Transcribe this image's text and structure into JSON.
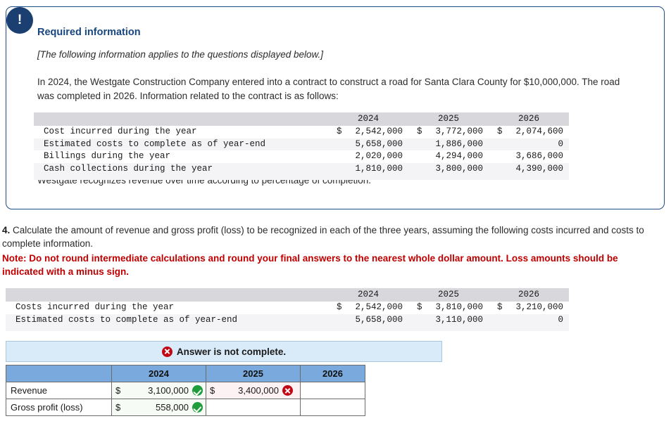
{
  "colors": {
    "panel_border": "#1f4e87",
    "badge_bg": "#1b3f70",
    "title_blue": "#17457e",
    "note_red": "#c00000",
    "banner_bg": "#d9eaf8",
    "banner_border": "#a9c9e2",
    "grid_header_blue": "#7aaadd",
    "correct_green": "#1f9c3b",
    "incorrect_red": "#c00713",
    "mono_header_gray": "#d7d7dc",
    "mono_stripe_gray": "#f4f4f6"
  },
  "required_info": {
    "badge_glyph": "!",
    "title": "Required information",
    "italic_note": "[The following information applies to the questions displayed below.]",
    "paragraph": "In 2024, the Westgate Construction Company entered into a contract to construct a road for Santa Clara County for $10,000,000. The road was completed in 2026. Information related to the contract is as follows:",
    "footer": "Westgate recognizes revenue over time according to percentage of completion."
  },
  "contract_table": {
    "blank_header": "",
    "columns": [
      "2024",
      "2025",
      "2026"
    ],
    "rows": [
      {
        "label": "Cost incurred during the year",
        "cells": [
          {
            "currency": "$",
            "amount": "2,542,000"
          },
          {
            "currency": "$",
            "amount": "3,772,000"
          },
          {
            "currency": "$",
            "amount": "2,074,600"
          }
        ]
      },
      {
        "label": "Estimated costs to complete as of year-end",
        "cells": [
          {
            "currency": "",
            "amount": "5,658,000"
          },
          {
            "currency": "",
            "amount": "1,886,000"
          },
          {
            "currency": "",
            "amount": "0"
          }
        ]
      },
      {
        "label": "Billings during the year",
        "cells": [
          {
            "currency": "",
            "amount": "2,020,000"
          },
          {
            "currency": "",
            "amount": "4,294,000"
          },
          {
            "currency": "",
            "amount": "3,686,000"
          }
        ]
      },
      {
        "label": "Cash collections during the year",
        "cells": [
          {
            "currency": "",
            "amount": "1,810,000"
          },
          {
            "currency": "",
            "amount": "3,800,000"
          },
          {
            "currency": "",
            "amount": "4,390,000"
          }
        ]
      }
    ]
  },
  "question": {
    "number": "4.",
    "text": "Calculate the amount of revenue and gross profit (loss) to be recognized in each of the three years, assuming the following costs incurred and costs to complete information.",
    "note": "Note: Do not round intermediate calculations and round your final answers to the nearest whole dollar amount. Loss amounts should be indicated with a minus sign."
  },
  "revised_costs_table": {
    "blank_header": "",
    "columns": [
      "2024",
      "2025",
      "2026"
    ],
    "rows": [
      {
        "label": "Costs incurred during the year",
        "cells": [
          {
            "currency": "$",
            "amount": "2,542,000"
          },
          {
            "currency": "$",
            "amount": "3,810,000"
          },
          {
            "currency": "$",
            "amount": "3,210,000"
          }
        ]
      },
      {
        "label": "Estimated costs to complete as of year-end",
        "cells": [
          {
            "currency": "",
            "amount": "5,658,000"
          },
          {
            "currency": "",
            "amount": "3,110,000"
          },
          {
            "currency": "",
            "amount": "0"
          }
        ]
      }
    ]
  },
  "answer_banner": {
    "icon": "incorrect-x-icon",
    "text": "Answer is not complete."
  },
  "answer_grid": {
    "corner_header": "",
    "columns": [
      "2024",
      "2025",
      "2026"
    ],
    "rows": [
      {
        "label": "Revenue",
        "cells": [
          {
            "currency": "$",
            "amount": "3,100,000",
            "status": "correct"
          },
          {
            "currency": "$",
            "amount": "3,400,000",
            "status": "incorrect"
          },
          {
            "currency": "",
            "amount": "",
            "status": "empty"
          }
        ]
      },
      {
        "label": "Gross profit (loss)",
        "cells": [
          {
            "currency": "$",
            "amount": "558,000",
            "status": "correct"
          },
          {
            "currency": "",
            "amount": "",
            "status": "empty"
          },
          {
            "currency": "",
            "amount": "",
            "status": "empty"
          }
        ]
      }
    ]
  }
}
